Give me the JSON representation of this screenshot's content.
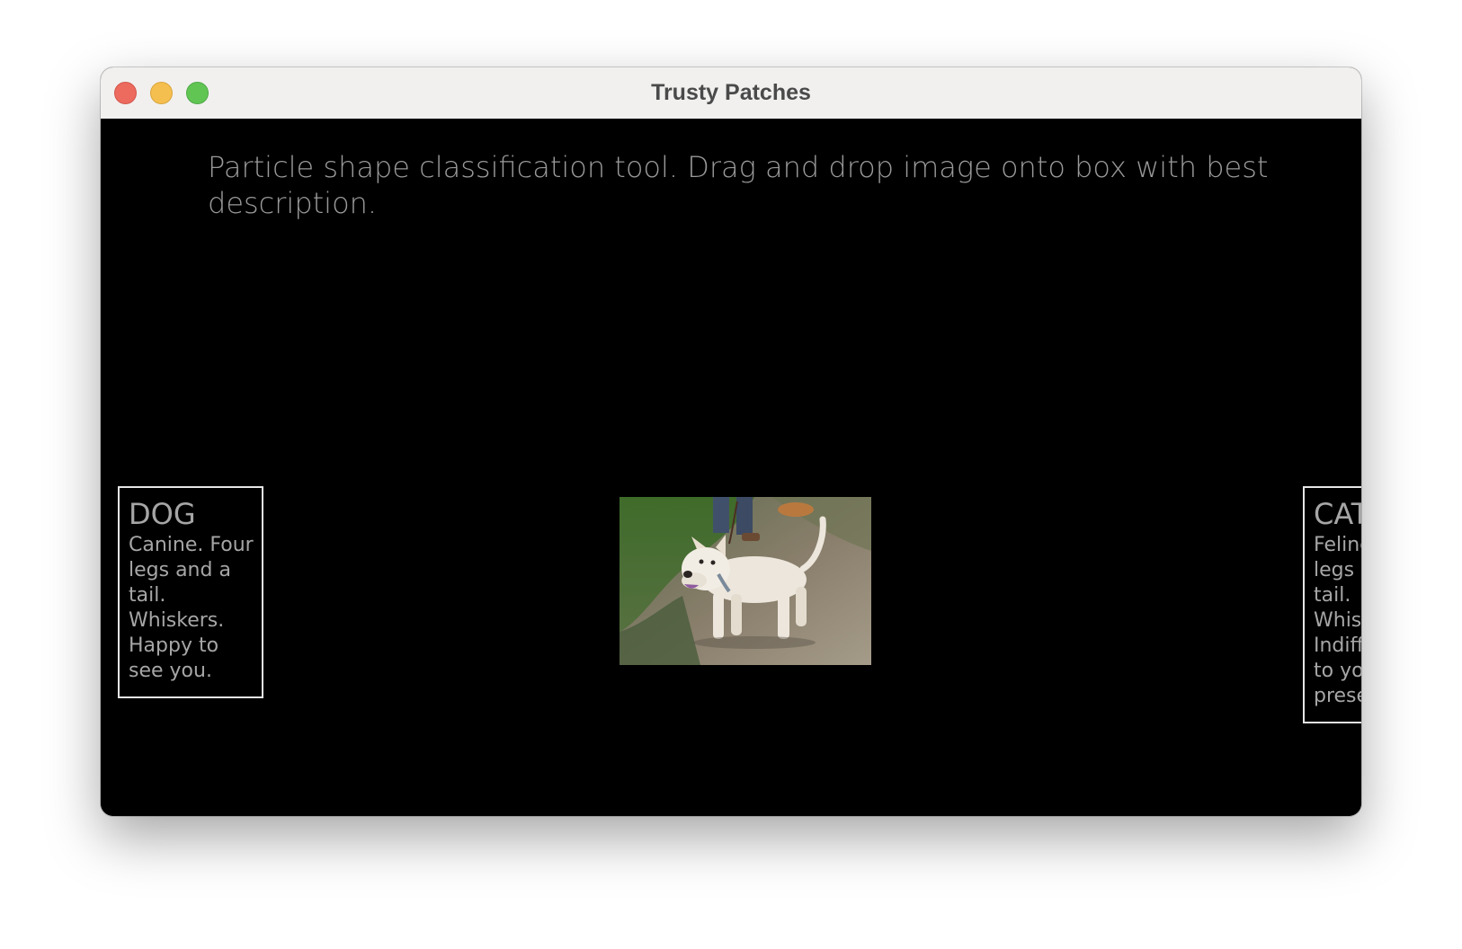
{
  "window": {
    "title": "Trusty Patches"
  },
  "main": {
    "instructions": "Particle shape classification tool. Drag and drop image onto box with best description.",
    "image": {
      "subject": "white dog on a leash standing on grass and dirt",
      "icon": "dog-photo"
    }
  },
  "categories": [
    {
      "title": "DOG",
      "description": "Canine. Four legs and a tail. Whiskers. Happy to see you."
    },
    {
      "title": "CAT",
      "description": "Feline. Four legs and a tail. Whiskers. Indifferent to your presence."
    }
  ],
  "colors": {
    "background": "#000000",
    "text": "#a6a6a6",
    "border": "#e6e6e6",
    "titlebar": "#f1f0ef"
  }
}
